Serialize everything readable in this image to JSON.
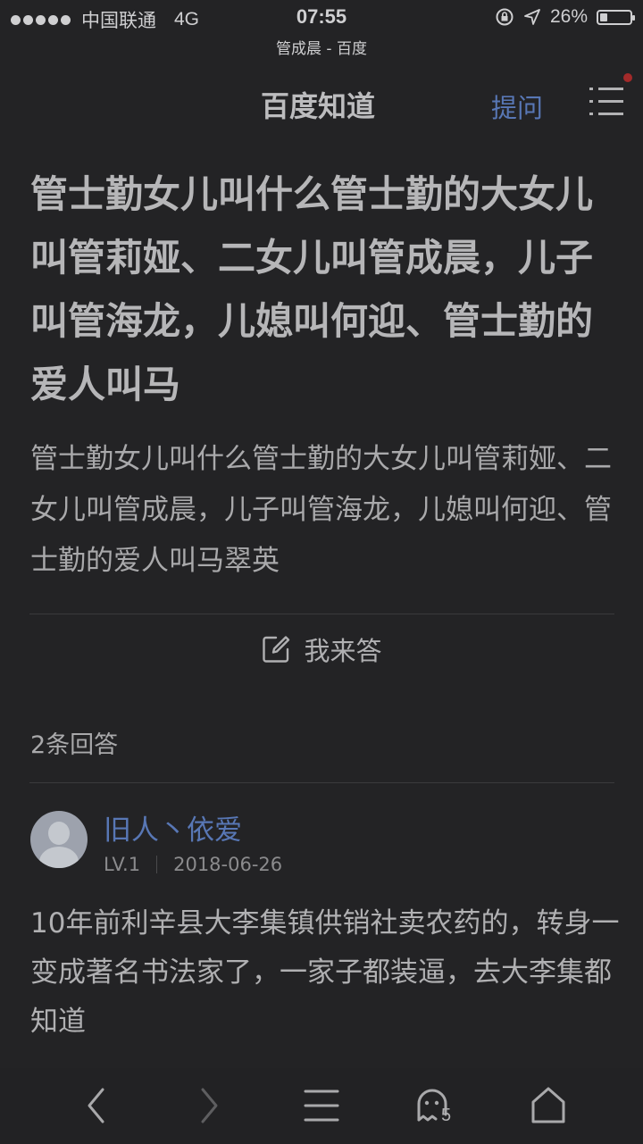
{
  "status_bar": {
    "carrier": "中国联通",
    "network": "4G",
    "time": "07:55",
    "battery": "26%",
    "battery_level": 0.26
  },
  "url_bar": {
    "title": "管成晨 - 百度"
  },
  "nav": {
    "title": "百度知道",
    "ask_label": "提问",
    "accent_color": "#5877b5",
    "notification_color": "#a32a2a"
  },
  "question": {
    "title": "管士勤女儿叫什么管士勤的大女儿叫管莉娅、二女儿叫管成晨，儿子叫管海龙，儿媳叫何迎、管士勤的爱人叫马",
    "description": "管士勤女儿叫什么管士勤的大女儿叫管莉娅、二女儿叫管成晨，儿子叫管海龙，儿媳叫何迎、管士勤的爱人叫马翠英"
  },
  "answer_button": {
    "label": "我来答"
  },
  "answers_count": "2条回答",
  "answer": {
    "username": "旧人丶依爱",
    "level": "LV.1",
    "date": "2018-06-26",
    "text": "10年前利辛县大李集镇供销社卖农药的，转身一变成著名书法家了，一家子都装逼，去大李集都知道"
  },
  "bottom_bar": {
    "tabs_count": "5"
  }
}
